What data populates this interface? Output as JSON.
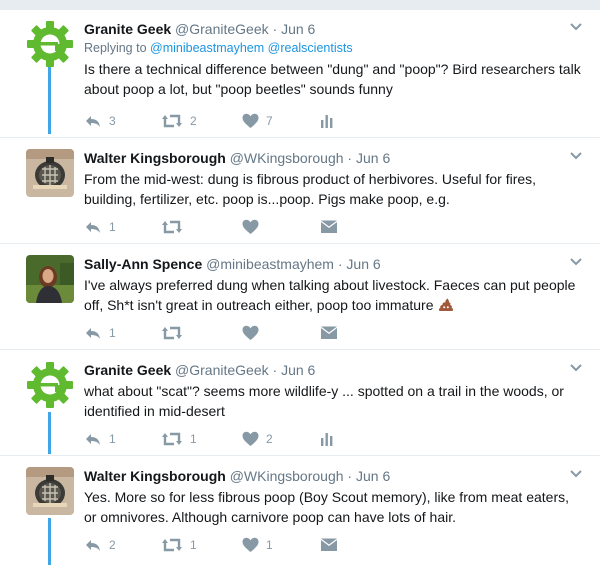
{
  "tweets": [
    {
      "name": "Granite Geek",
      "handle": "@GraniteGeek",
      "sep": "·",
      "date": "Jun 6",
      "replying_prefix": "Replying to",
      "replying_to": [
        "@minibeastmayhem",
        "@realscientists"
      ],
      "text": "Is there a technical difference between \"dung\" and \"poop\"? Bird researchers talk about poop a lot, but \"poop beetles\" sounds funny",
      "reply_count": "3",
      "retweet_count": "2",
      "like_count": "7"
    },
    {
      "name": "Walter Kingsborough",
      "handle": "@WKingsborough",
      "sep": "·",
      "date": "Jun 6",
      "text": "From the mid-west: dung is fibrous product of herbivores. Useful for fires, building, fertilizer, etc. poop is...poop. Pigs make poop, e.g.",
      "reply_count": "1",
      "retweet_count": "",
      "like_count": ""
    },
    {
      "name": "Sally-Ann Spence",
      "handle": "@minibeastmayhem",
      "sep": "·",
      "date": "Jun 6",
      "text": "I've always preferred dung when talking about livestock. Faeces can put people off, Sh*t isn't great in outreach either, poop too immature",
      "reply_count": "1",
      "retweet_count": "",
      "like_count": ""
    },
    {
      "name": "Granite Geek",
      "handle": "@GraniteGeek",
      "sep": "·",
      "date": "Jun 6",
      "text": "what about \"scat\"? seems more wildlife-y ... spotted on a trail in the woods, or identified in mid-desert",
      "reply_count": "1",
      "retweet_count": "1",
      "like_count": "2"
    },
    {
      "name": "Walter Kingsborough",
      "handle": "@WKingsborough",
      "sep": "·",
      "date": "Jun 6",
      "text": "Yes. More so for less fibrous poop (Boy Scout memory), like from meat eaters, or omnivores. Although carnivore poop can have lots of hair.",
      "reply_count": "2",
      "retweet_count": "1",
      "like_count": "1"
    }
  ],
  "colors": {
    "thread_line": "#40a6e8",
    "link": "#1b95e0",
    "icon": "#8899a6",
    "geek_green": "#5fba2f"
  },
  "icons": [
    "gear-logo-icon",
    "reply-icon",
    "retweet-icon",
    "like-icon",
    "analytics-icon",
    "message-icon",
    "chevron-down-icon",
    "poop-emoji-icon"
  ]
}
